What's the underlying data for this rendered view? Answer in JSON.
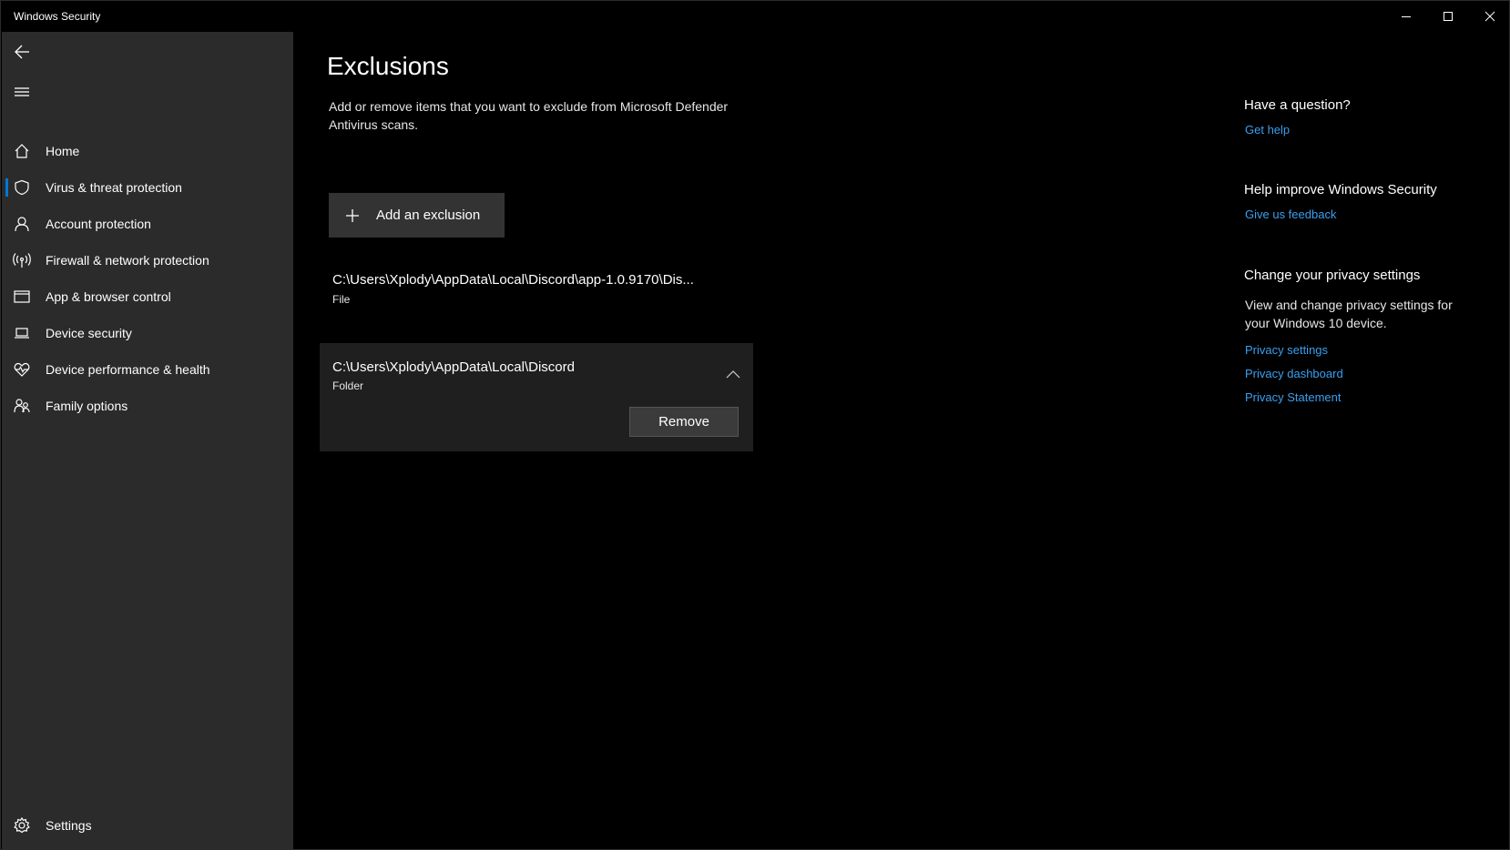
{
  "window": {
    "title": "Windows Security",
    "controls": {
      "minimize": "minimize-icon",
      "maximize": "maximize-icon",
      "close": "close-icon"
    }
  },
  "sidebar": {
    "items": [
      {
        "label": "Home",
        "icon": "home-icon"
      },
      {
        "label": "Virus & threat protection",
        "icon": "shield-icon",
        "active": true
      },
      {
        "label": "Account protection",
        "icon": "person-icon"
      },
      {
        "label": "Firewall & network protection",
        "icon": "wireless-icon"
      },
      {
        "label": "App & browser control",
        "icon": "browser-window-icon"
      },
      {
        "label": "Device security",
        "icon": "laptop-icon"
      },
      {
        "label": "Device performance & health",
        "icon": "heart-icon"
      },
      {
        "label": "Family options",
        "icon": "family-icon"
      }
    ],
    "settings_label": "Settings"
  },
  "main": {
    "title": "Exclusions",
    "description": "Add or remove items that you want to exclude from Microsoft Defender Antivirus scans.",
    "add_button_label": "Add an exclusion",
    "exclusions": [
      {
        "path": "C:\\Users\\Xplody\\AppData\\Local\\Discord\\app-1.0.9170\\Dis...",
        "type": "File",
        "expanded": false
      },
      {
        "path": "C:\\Users\\Xplody\\AppData\\Local\\Discord",
        "type": "Folder",
        "expanded": true,
        "remove_label": "Remove"
      }
    ]
  },
  "right_panel": {
    "question_heading": "Have a question?",
    "get_help_link": "Get help",
    "improve_heading": "Help improve Windows Security",
    "feedback_link": "Give us feedback",
    "privacy_heading": "Change your privacy settings",
    "privacy_text": "View and change privacy settings for your Windows 10 device.",
    "privacy_links": [
      "Privacy settings",
      "Privacy dashboard",
      "Privacy Statement"
    ]
  },
  "colors": {
    "accent": "#0078d7",
    "link": "#3a9ff0",
    "sidebar_bg": "#2b2b2b",
    "background": "#000000"
  }
}
